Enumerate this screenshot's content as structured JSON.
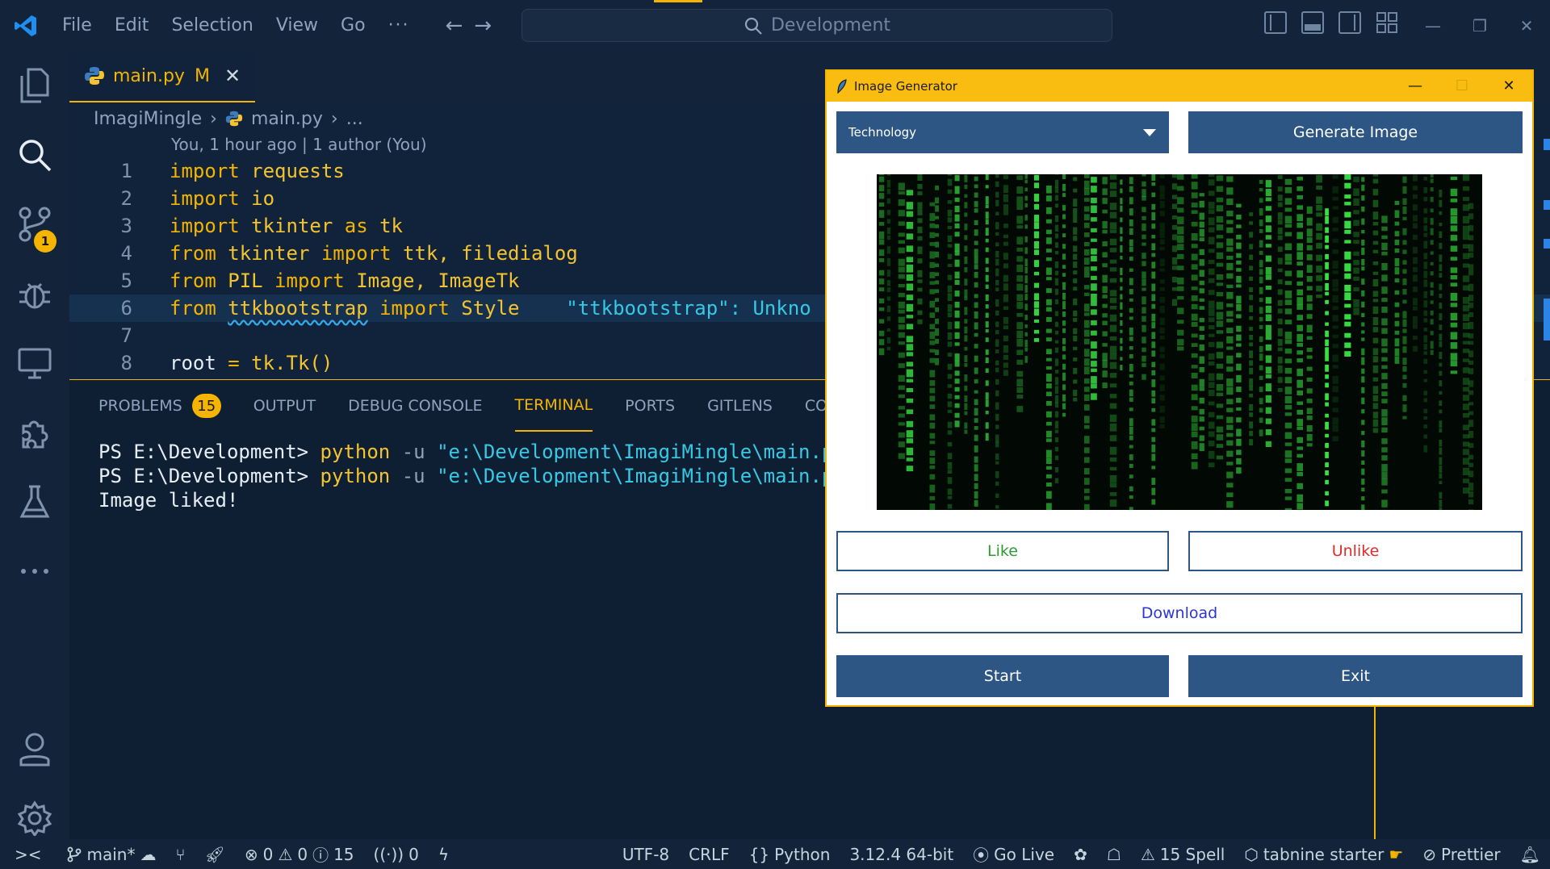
{
  "titlebar": {
    "menu": [
      "File",
      "Edit",
      "Selection",
      "View",
      "Go"
    ],
    "more": "···",
    "search": "Development",
    "controls": {
      "minimize": "—",
      "restore": "❐",
      "close": "✕"
    }
  },
  "activity": {
    "scm_badge": "1"
  },
  "editor": {
    "tab": {
      "name": "main.py",
      "modified": "M",
      "close": "✕"
    },
    "breadcrumb": {
      "folder": "ImagiMingle",
      "file": "main.py",
      "more": "..."
    },
    "blame": "You, 1 hour ago | 1 author (You)",
    "lines": [
      {
        "n": "1"
      },
      {
        "n": "2"
      },
      {
        "n": "3"
      },
      {
        "n": "4"
      },
      {
        "n": "5"
      },
      {
        "n": "6"
      },
      {
        "n": "7"
      },
      {
        "n": "8"
      }
    ],
    "code": {
      "l1a": "import",
      "l1b": " requests",
      "l2a": "import",
      "l2b": " io",
      "l3a": "import",
      "l3b": " tkinter ",
      "l3c": "as",
      "l3d": " tk",
      "l4a": "from",
      "l4b": " tkinter ",
      "l4c": "import",
      "l4d": " ttk, filedialog",
      "l5a": "from",
      "l5b": " PIL ",
      "l5c": "import",
      "l5d": " Image, ImageTk",
      "l6a": "from",
      "l6b": "ttkbootstrap",
      "l6c": "import",
      "l6d": " Style",
      "l6e": "\"ttkbootstrap\": Unkno",
      "l8a": "root",
      "l8b": " = ",
      "l8c": "tk.Tk()"
    }
  },
  "panel": {
    "tabs": [
      "PROBLEMS",
      "OUTPUT",
      "DEBUG CONSOLE",
      "TERMINAL",
      "PORTS",
      "GITLENS",
      "COM"
    ],
    "problems_count": "15",
    "terminal": {
      "prompt": "PS E:\\Development>",
      "cmd": "python",
      "flag": "-u",
      "path": "\"e:\\Development\\ImagiMingle\\main.py",
      "output": "Image liked!"
    }
  },
  "status": {
    "branch": "main*",
    "errors": "0",
    "warnings": "0",
    "infos": "15",
    "ports": "0",
    "encoding": "UTF-8",
    "eol": "CRLF",
    "language": "Python",
    "interpreter": "3.12.4 64-bit",
    "golive": "Go Live",
    "spell": "15 Spell",
    "tabnine": "tabnine starter",
    "prettier": "Prettier"
  },
  "app": {
    "title": "Image Generator",
    "category": "Technology",
    "generate_label": "Generate Image",
    "like_label": "Like",
    "unlike_label": "Unlike",
    "download_label": "Download",
    "start_label": "Start",
    "exit_label": "Exit",
    "controls": {
      "minimize": "—",
      "maximize": "☐",
      "close": "✕"
    }
  },
  "colors": {
    "accent": "#f4b400",
    "button": "#2d5684",
    "like": "#2e9a34",
    "unlike": "#e02b2b",
    "download": "#2836d8"
  }
}
